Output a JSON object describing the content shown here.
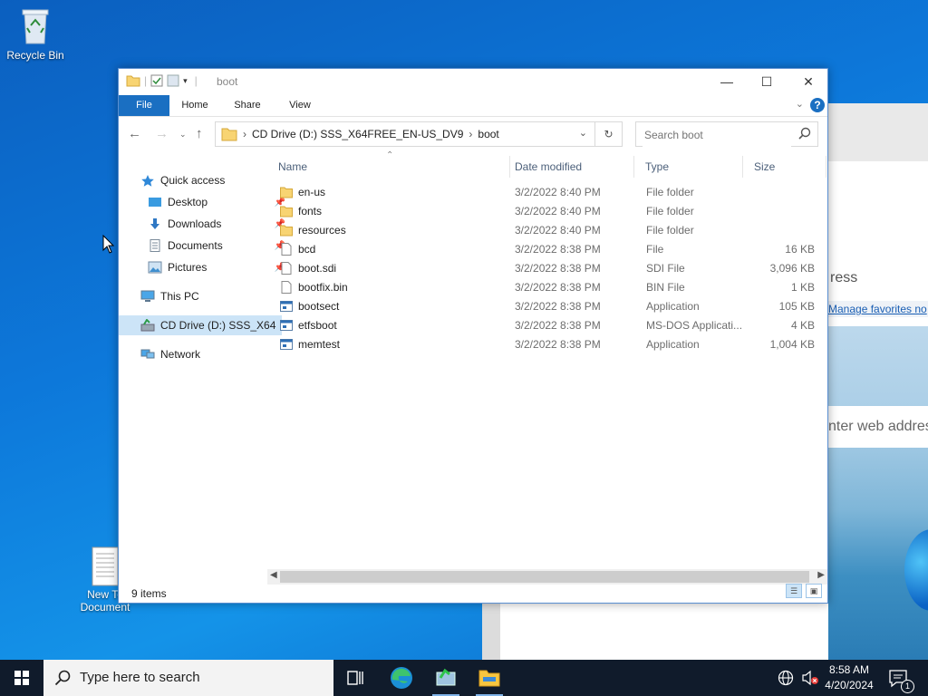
{
  "desktop": {
    "recycle_bin_label": "Recycle Bin",
    "new_doc_label_line1": "New Te",
    "new_doc_label_line2": "Document"
  },
  "background_window": {
    "address_text": "ress",
    "favorites_text": "Manage favorites no",
    "web_address_text": "nter web addres"
  },
  "explorer": {
    "title": "boot",
    "ribbon_tabs": [
      "File",
      "Home",
      "Share",
      "View"
    ],
    "address": {
      "crumbs": [
        "CD Drive (D:) SSS_X64FREE_EN-US_DV9",
        "boot"
      ]
    },
    "search_placeholder": "Search boot",
    "nav": {
      "quick_access": "Quick access",
      "items": [
        {
          "label": "Desktop",
          "icon": "desktop-icon"
        },
        {
          "label": "Downloads",
          "icon": "download-icon"
        },
        {
          "label": "Documents",
          "icon": "documents-icon"
        },
        {
          "label": "Pictures",
          "icon": "pictures-icon"
        }
      ],
      "this_pc": "This PC",
      "cd_drive": "CD Drive (D:) SSS_X64",
      "network": "Network"
    },
    "columns": [
      "Name",
      "Date modified",
      "Type",
      "Size"
    ],
    "files": [
      {
        "name": "en-us",
        "date": "3/2/2022 8:40 PM",
        "type": "File folder",
        "size": "",
        "kind": "folder"
      },
      {
        "name": "fonts",
        "date": "3/2/2022 8:40 PM",
        "type": "File folder",
        "size": "",
        "kind": "folder"
      },
      {
        "name": "resources",
        "date": "3/2/2022 8:40 PM",
        "type": "File folder",
        "size": "",
        "kind": "folder"
      },
      {
        "name": "bcd",
        "date": "3/2/2022 8:38 PM",
        "type": "File",
        "size": "16 KB",
        "kind": "file"
      },
      {
        "name": "boot.sdi",
        "date": "3/2/2022 8:38 PM",
        "type": "SDI File",
        "size": "3,096 KB",
        "kind": "file"
      },
      {
        "name": "bootfix.bin",
        "date": "3/2/2022 8:38 PM",
        "type": "BIN File",
        "size": "1 KB",
        "kind": "file"
      },
      {
        "name": "bootsect",
        "date": "3/2/2022 8:38 PM",
        "type": "Application",
        "size": "105 KB",
        "kind": "app"
      },
      {
        "name": "etfsboot",
        "date": "3/2/2022 8:38 PM",
        "type": "MS-DOS Applicati...",
        "size": "4 KB",
        "kind": "app"
      },
      {
        "name": "memtest",
        "date": "3/2/2022 8:38 PM",
        "type": "Application",
        "size": "1,004 KB",
        "kind": "app"
      }
    ],
    "status": "9 items"
  },
  "taskbar": {
    "search_placeholder": "Type here to search",
    "time": "8:58 AM",
    "date": "4/20/2024",
    "notification_count": "1"
  },
  "colors": {
    "accent": "#1a6fc2",
    "taskbar": "#101b2b",
    "folder": "#f8d472",
    "selection": "#cce4f7"
  }
}
